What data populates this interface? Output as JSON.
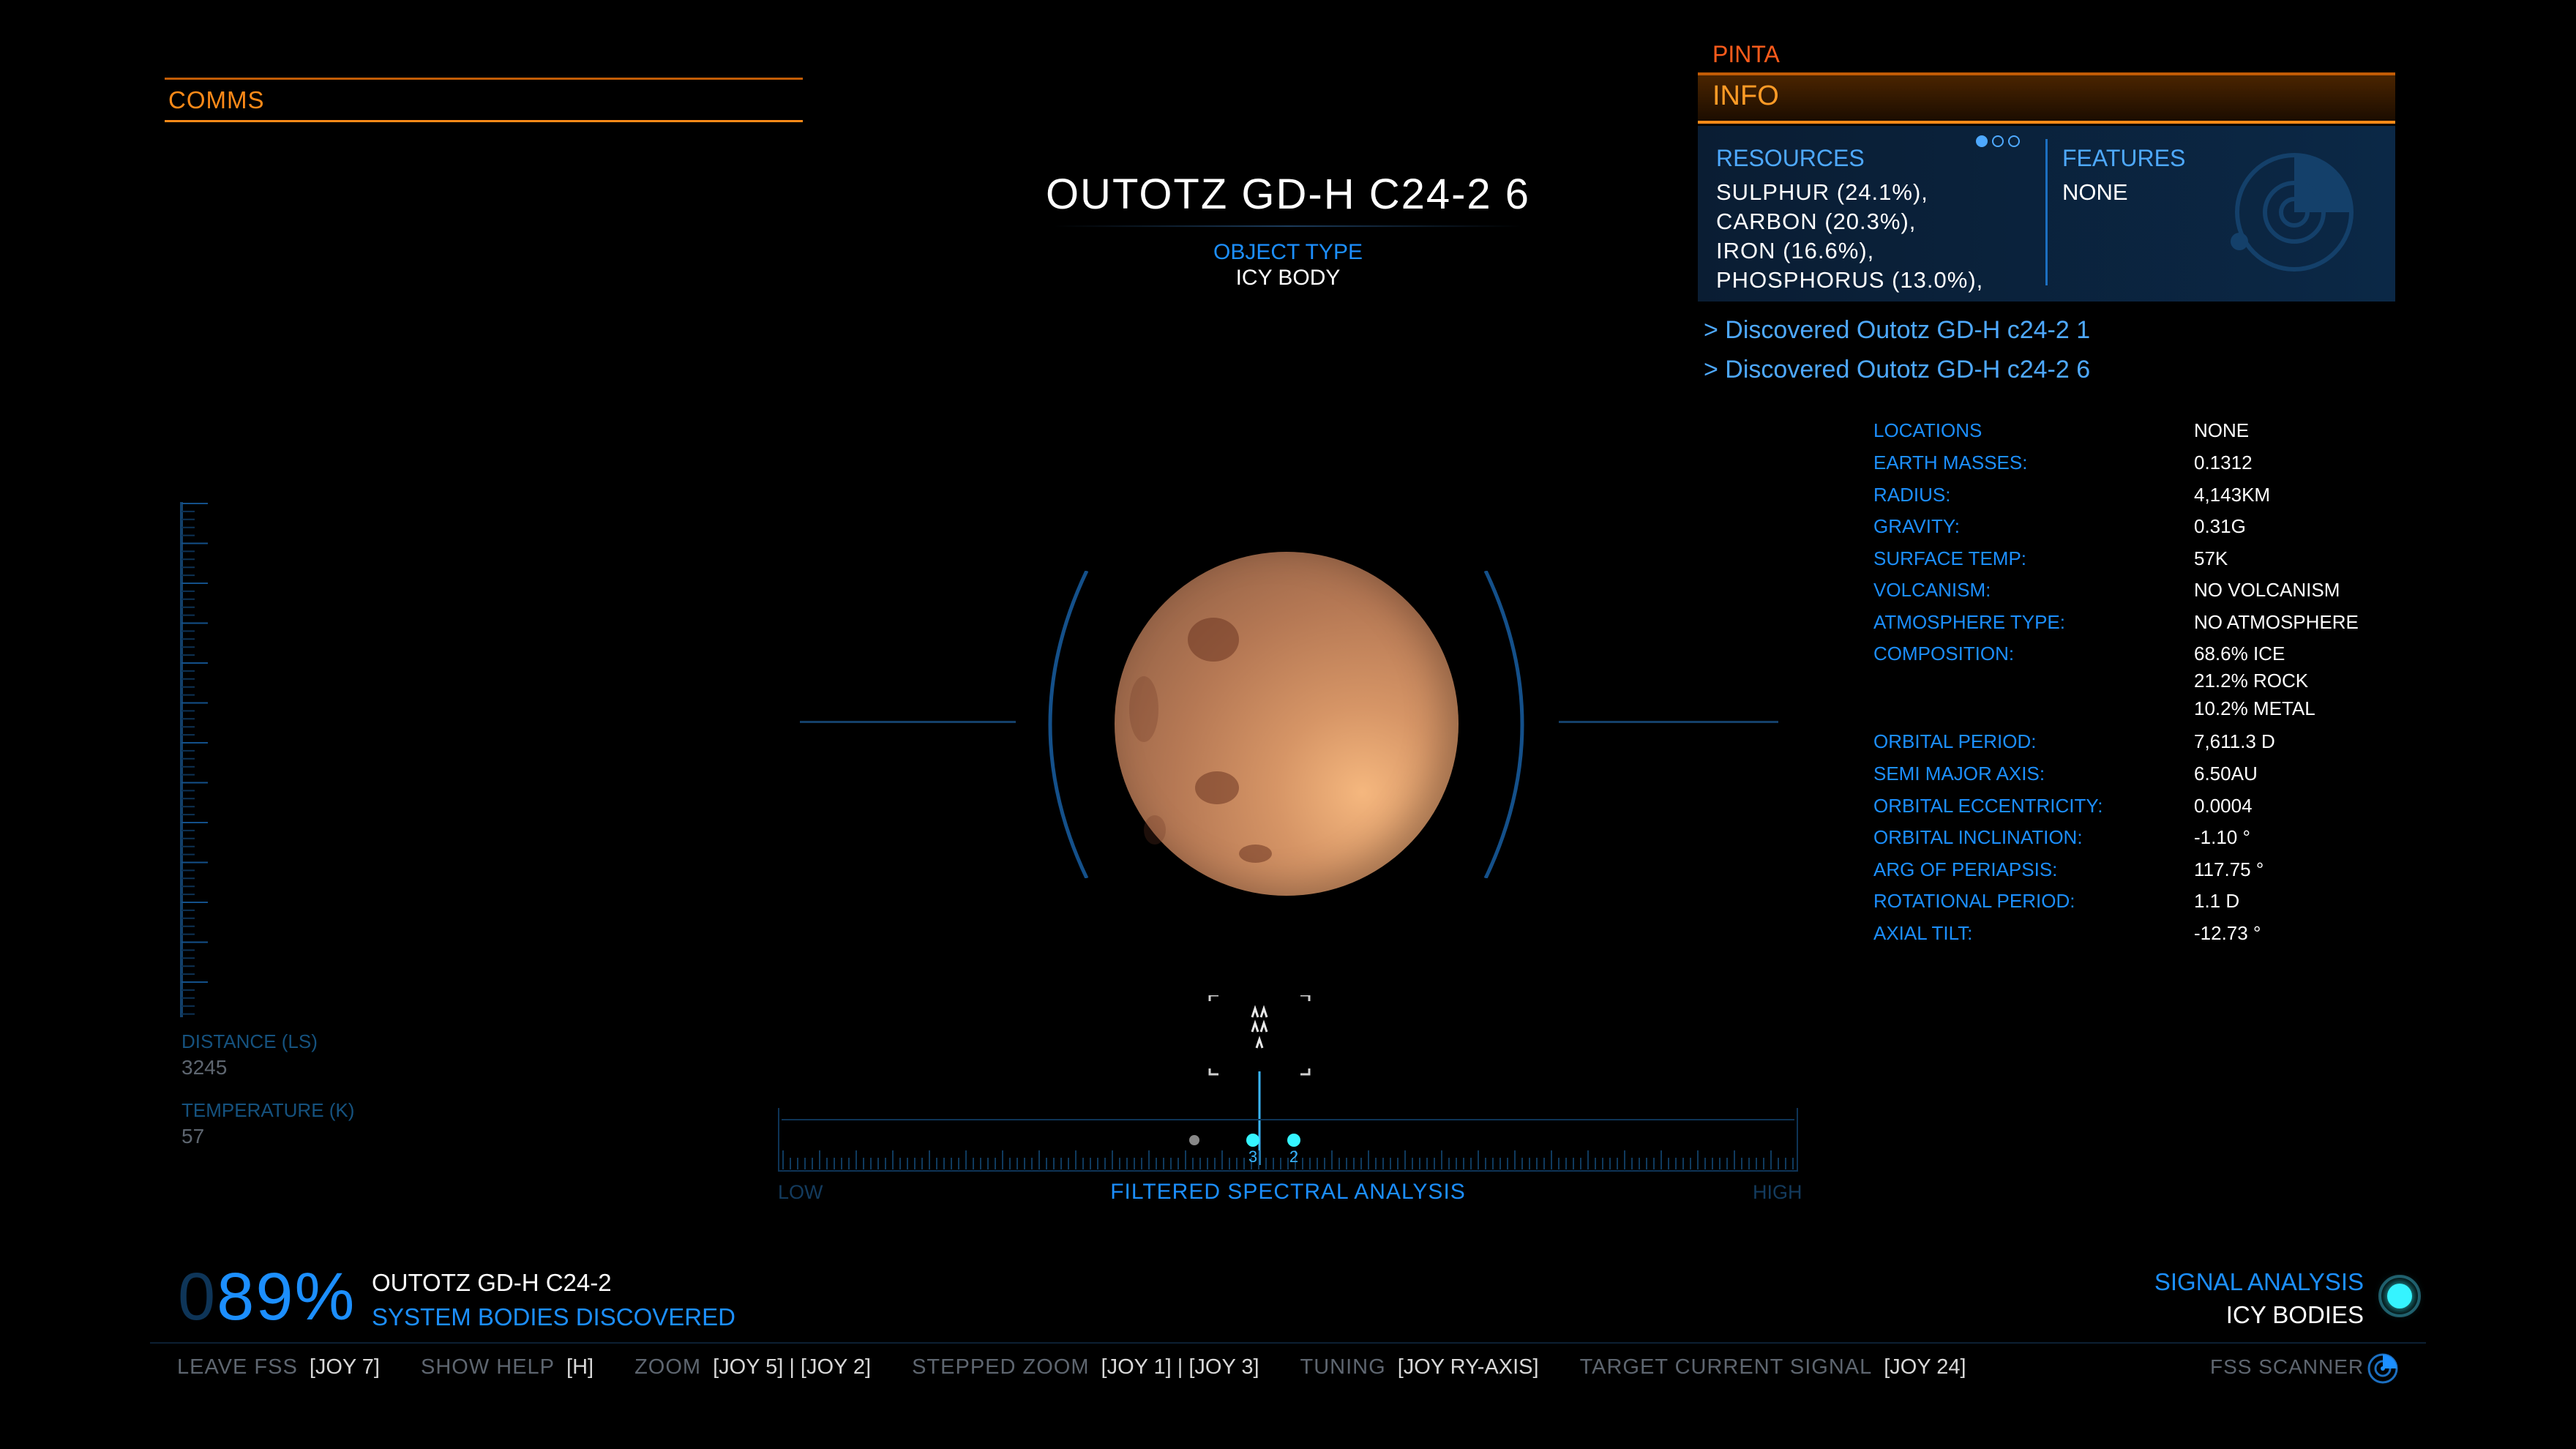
{
  "comms": {
    "title": "COMMS"
  },
  "target": {
    "name": "OUTOTZ GD-H C24-2 6",
    "object_type_label": "OBJECT TYPE",
    "object_type_value": "ICY BODY"
  },
  "info_panel": {
    "ship_name": "PINTA",
    "title": "INFO",
    "resources_heading": "RESOURCES",
    "resources": [
      "SULPHUR (24.1%),",
      "CARBON (20.3%),",
      "IRON (16.6%),",
      "PHOSPHORUS (13.0%),"
    ],
    "features_heading": "FEATURES",
    "features_value": "NONE",
    "discovered": [
      "> Discovered Outotz GD-H c24-2 1",
      "> Discovered Outotz GD-H c24-2 6"
    ]
  },
  "stats": [
    {
      "label": "LOCATIONS",
      "value": "NONE"
    },
    {
      "label": "EARTH MASSES:",
      "value": "0.1312"
    },
    {
      "label": "RADIUS:",
      "value": "4,143KM"
    },
    {
      "label": "GRAVITY:",
      "value": "0.31G"
    },
    {
      "label": "SURFACE TEMP:",
      "value": "57K"
    },
    {
      "label": "VOLCANISM:",
      "value": "NO VOLCANISM"
    },
    {
      "label": "ATMOSPHERE TYPE:",
      "value": "NO ATMOSPHERE"
    },
    {
      "label": "COMPOSITION:",
      "value": "68.6% ICE"
    },
    {
      "label": "",
      "value": "21.2% ROCK"
    },
    {
      "label": "",
      "value": "10.2% METAL"
    },
    {
      "label": "ORBITAL PERIOD:",
      "value": "7,611.3 D"
    },
    {
      "label": "SEMI MAJOR AXIS:",
      "value": "6.50AU"
    },
    {
      "label": "ORBITAL ECCENTRICITY:",
      "value": "0.0004"
    },
    {
      "label": "ORBITAL INCLINATION:",
      "value": "-1.10 °"
    },
    {
      "label": "ARG OF PERIAPSIS:",
      "value": "117.75 °"
    },
    {
      "label": "ROTATIONAL PERIOD:",
      "value": "1.1 D"
    },
    {
      "label": "AXIAL TILT:",
      "value": "-12.73 °"
    }
  ],
  "gauge": {
    "distance_label": "DISTANCE (LS)",
    "distance_value": "3245",
    "temperature_label": "TEMPERATURE (K)",
    "temperature_value": "57"
  },
  "spectral": {
    "low_label": "LOW",
    "high_label": "HIGH",
    "title": "FILTERED SPECTRAL ANALYSIS",
    "signal_markers": [
      "3",
      "2"
    ]
  },
  "progress": {
    "percent_lead": "0",
    "percent_rest": "89%",
    "system_name": "OUTOTZ GD-H C24-2",
    "caption": "SYSTEM BODIES DISCOVERED"
  },
  "signal": {
    "label": "SIGNAL ANALYSIS",
    "value": "ICY BODIES"
  },
  "keybinds": [
    {
      "label": "LEAVE FSS",
      "key": "[JOY 7]"
    },
    {
      "label": "SHOW HELP",
      "key": "[H]"
    },
    {
      "label": "ZOOM",
      "key": "[JOY 5] | [JOY 2]"
    },
    {
      "label": "STEPPED ZOOM",
      "key": "[JOY 1] | [JOY 3]"
    },
    {
      "label": "TUNING",
      "key": "[JOY RY-AXIS]"
    },
    {
      "label": "TARGET CURRENT SIGNAL",
      "key": "[JOY 24]"
    }
  ],
  "scanner": {
    "label": "FSS SCANNER"
  },
  "colors": {
    "accent_orange": "#ff8a18",
    "accent_blue": "#1c8fff",
    "signal_cyan": "#35f4ff"
  }
}
